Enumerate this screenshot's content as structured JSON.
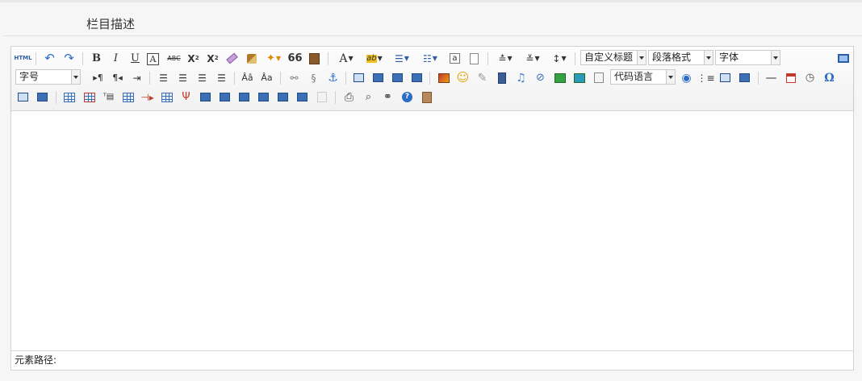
{
  "field": {
    "title": "栏目描述"
  },
  "editor": {
    "combos": {
      "custom_heading": "自定义标题",
      "paragraph_format": "段落格式",
      "font_family": "字体",
      "font_size": "字号",
      "code_language": "代码语言"
    },
    "labels": {
      "html": "HTML",
      "bold": "B",
      "italic": "I",
      "underline": "U",
      "frame_text": "A",
      "strikethrough": "ABC",
      "superscript": "X",
      "subscript": "X",
      "quote": "66",
      "font_color": "A",
      "highlight": "ab",
      "special_char": "Ω"
    },
    "status": {
      "path_label": "元素路径:"
    },
    "colors": {
      "accent": "#3b6fb6",
      "border": "#d4d4d4",
      "toolbar_bg": "#f1f1f1"
    }
  }
}
